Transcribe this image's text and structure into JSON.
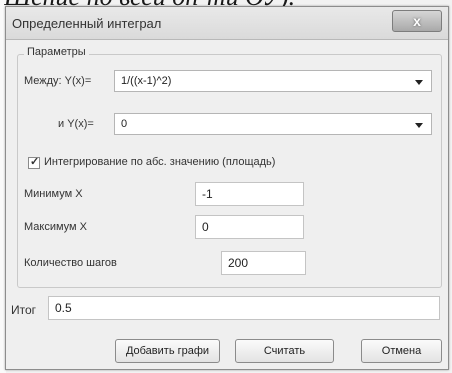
{
  "background": {
    "cut_text": "Шение по всей оп-ти ОУ)."
  },
  "dialog": {
    "title": "Определенный интеграл",
    "close_label": "x"
  },
  "params": {
    "legend": "Параметры",
    "between_label": "Между: Y(x)=",
    "between_value": "1/((x-1)^2)",
    "and_label": "и Y(x)=",
    "and_value": "0",
    "abs_checkbox_label": "Интегрирование по абс. значению (площадь)",
    "abs_checkbox_checked": true,
    "min_x_label": "Минимум X",
    "min_x_value": "-1",
    "max_x_label": "Максимум X",
    "max_x_value": "0",
    "steps_label": "Количество шагов",
    "steps_value": "200"
  },
  "result": {
    "label": "Итог",
    "value": "0.5"
  },
  "buttons": {
    "add_graph": "Добавить графи",
    "calculate": "Считать",
    "cancel": "Отмена"
  }
}
